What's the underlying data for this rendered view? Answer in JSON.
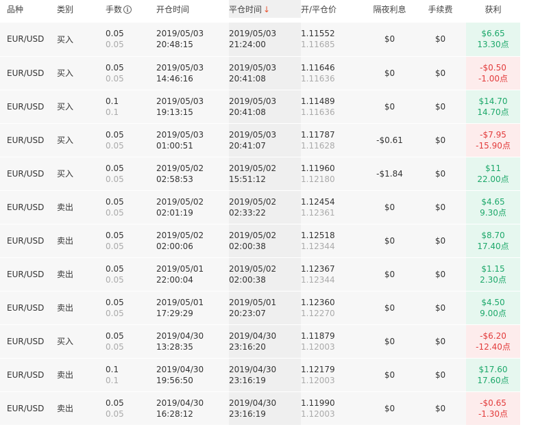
{
  "headers": {
    "symbol": "品种",
    "type": "类别",
    "lots": "手数",
    "open_time": "开仓时间",
    "close_time": "平仓时间",
    "price": "开/平仓价",
    "swap": "隔夜利息",
    "commission": "手续费",
    "profit": "获利"
  },
  "colors": {
    "profit_text": "#1da86a",
    "profit_bg": "#e6f7ef",
    "loss_text": "#e23b3b",
    "loss_bg": "#fdecec",
    "sort_arrow": "#e8532f"
  },
  "sort": {
    "column": "close_time",
    "direction": "desc",
    "icon": "arrow-down-icon"
  },
  "rows": [
    {
      "symbol": "EUR/USD",
      "type": "买入",
      "lots": "0.05",
      "lots_sub": "0.05",
      "open_date": "2019/05/03",
      "open_time": "20:48:15",
      "close_date": "2019/05/03",
      "close_time": "21:24:00",
      "open_price": "1.11552",
      "close_price": "1.11685",
      "swap": "$0",
      "commission": "$0",
      "profit": "$6.65",
      "points": "13.30点",
      "status": "profit"
    },
    {
      "symbol": "EUR/USD",
      "type": "买入",
      "lots": "0.05",
      "lots_sub": "0.05",
      "open_date": "2019/05/03",
      "open_time": "14:46:16",
      "close_date": "2019/05/03",
      "close_time": "20:41:08",
      "open_price": "1.11646",
      "close_price": "1.11636",
      "swap": "$0",
      "commission": "$0",
      "profit": "-$0.50",
      "points": "-1.00点",
      "status": "loss"
    },
    {
      "symbol": "EUR/USD",
      "type": "买入",
      "lots": "0.1",
      "lots_sub": "0.1",
      "open_date": "2019/05/03",
      "open_time": "19:13:15",
      "close_date": "2019/05/03",
      "close_time": "20:41:08",
      "open_price": "1.11489",
      "close_price": "1.11636",
      "swap": "$0",
      "commission": "$0",
      "profit": "$14.70",
      "points": "14.70点",
      "status": "profit"
    },
    {
      "symbol": "EUR/USD",
      "type": "买入",
      "lots": "0.05",
      "lots_sub": "0.05",
      "open_date": "2019/05/03",
      "open_time": "01:00:51",
      "close_date": "2019/05/03",
      "close_time": "20:41:07",
      "open_price": "1.11787",
      "close_price": "1.11628",
      "swap": "-$0.61",
      "commission": "$0",
      "profit": "-$7.95",
      "points": "-15.90点",
      "status": "loss"
    },
    {
      "symbol": "EUR/USD",
      "type": "买入",
      "lots": "0.05",
      "lots_sub": "0.05",
      "open_date": "2019/05/02",
      "open_time": "02:58:53",
      "close_date": "2019/05/02",
      "close_time": "15:51:12",
      "open_price": "1.11960",
      "close_price": "1.12180",
      "swap": "-$1.84",
      "commission": "$0",
      "profit": "$11",
      "points": "22.00点",
      "status": "profit"
    },
    {
      "symbol": "EUR/USD",
      "type": "卖出",
      "lots": "0.05",
      "lots_sub": "0.05",
      "open_date": "2019/05/02",
      "open_time": "02:01:19",
      "close_date": "2019/05/02",
      "close_time": "02:33:22",
      "open_price": "1.12454",
      "close_price": "1.12361",
      "swap": "$0",
      "commission": "$0",
      "profit": "$4.65",
      "points": "9.30点",
      "status": "profit"
    },
    {
      "symbol": "EUR/USD",
      "type": "卖出",
      "lots": "0.05",
      "lots_sub": "0.05",
      "open_date": "2019/05/02",
      "open_time": "02:00:06",
      "close_date": "2019/05/02",
      "close_time": "02:00:38",
      "open_price": "1.12518",
      "close_price": "1.12344",
      "swap": "$0",
      "commission": "$0",
      "profit": "$8.70",
      "points": "17.40点",
      "status": "profit"
    },
    {
      "symbol": "EUR/USD",
      "type": "卖出",
      "lots": "0.05",
      "lots_sub": "0.05",
      "open_date": "2019/05/01",
      "open_time": "22:00:04",
      "close_date": "2019/05/02",
      "close_time": "02:00:38",
      "open_price": "1.12367",
      "close_price": "1.12344",
      "swap": "$0",
      "commission": "$0",
      "profit": "$1.15",
      "points": "2.30点",
      "status": "profit"
    },
    {
      "symbol": "EUR/USD",
      "type": "卖出",
      "lots": "0.05",
      "lots_sub": "0.05",
      "open_date": "2019/05/01",
      "open_time": "17:29:29",
      "close_date": "2019/05/01",
      "close_time": "20:23:07",
      "open_price": "1.12360",
      "close_price": "1.12270",
      "swap": "$0",
      "commission": "$0",
      "profit": "$4.50",
      "points": "9.00点",
      "status": "profit"
    },
    {
      "symbol": "EUR/USD",
      "type": "买入",
      "lots": "0.05",
      "lots_sub": "0.05",
      "open_date": "2019/04/30",
      "open_time": "13:28:35",
      "close_date": "2019/04/30",
      "close_time": "23:16:20",
      "open_price": "1.11879",
      "close_price": "1.12003",
      "swap": "$0",
      "commission": "$0",
      "profit": "-$6.20",
      "points": "-12.40点",
      "status": "loss"
    },
    {
      "symbol": "EUR/USD",
      "type": "卖出",
      "lots": "0.1",
      "lots_sub": "0.1",
      "open_date": "2019/04/30",
      "open_time": "19:56:50",
      "close_date": "2019/04/30",
      "close_time": "23:16:19",
      "open_price": "1.12179",
      "close_price": "1.12003",
      "swap": "$0",
      "commission": "$0",
      "profit": "$17.60",
      "points": "17.60点",
      "status": "profit"
    },
    {
      "symbol": "EUR/USD",
      "type": "卖出",
      "lots": "0.05",
      "lots_sub": "0.05",
      "open_date": "2019/04/30",
      "open_time": "16:28:12",
      "close_date": "2019/04/30",
      "close_time": "23:16:19",
      "open_price": "1.11990",
      "close_price": "1.12003",
      "swap": "$0",
      "commission": "$0",
      "profit": "-$0.65",
      "points": "-1.30点",
      "status": "loss"
    }
  ]
}
